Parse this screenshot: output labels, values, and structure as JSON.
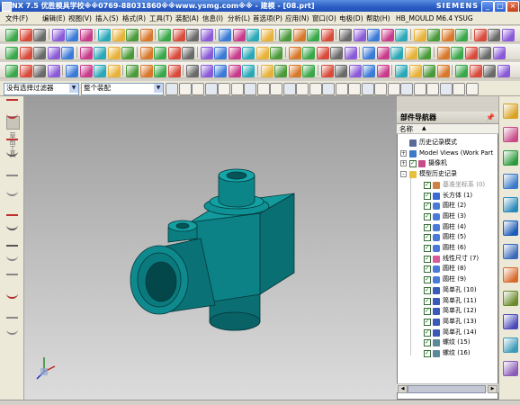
{
  "window": {
    "title": "NX 7.5 优胜模具学校※※0769-88031860※※www.ysmg.com※※ - 建模 - [08.prt]",
    "brand": "SIEMENS",
    "controls": [
      "_",
      "□",
      "×"
    ]
  },
  "menu": {
    "items": [
      "文件(F)",
      "编辑(E)",
      "视图(V)",
      "插入(S)",
      "格式(R)",
      "工具(T)",
      "装配(A)",
      "信息(I)",
      "分析(L)",
      "首选项(P)",
      "应用(N)",
      "窗口(O)",
      "电极(D)",
      "帮助(H)",
      "HB_MOULD M6.4",
      "YSUG"
    ]
  },
  "filter_bar": {
    "selection_filter": "没有选择过滤器",
    "scope": "整个装配"
  },
  "navigator": {
    "title": "部件导航器",
    "column_name": "名称",
    "rows": [
      {
        "label": "历史记录模式",
        "indent": 0,
        "expander": "",
        "checked": false,
        "icon": "history-mode-icon",
        "dim": false
      },
      {
        "label": "Model Views (Work Part)",
        "indent": 0,
        "expander": "+",
        "checked": false,
        "icon": "model-views-icon",
        "dim": false
      },
      {
        "label": "摄像机",
        "indent": 0,
        "expander": "+",
        "checked": true,
        "icon": "camera-icon",
        "dim": false
      },
      {
        "label": "模型历史记录",
        "indent": 0,
        "expander": "-",
        "checked": false,
        "icon": "folder-icon",
        "dim": false
      },
      {
        "label": "基准坐标系 (0)",
        "indent": 1,
        "expander": "",
        "checked": true,
        "icon": "datum-csys-icon",
        "dim": true
      },
      {
        "label": "长方体 (1)",
        "indent": 1,
        "expander": "",
        "checked": true,
        "icon": "block-icon",
        "dim": false
      },
      {
        "label": "圆柱 (2)",
        "indent": 1,
        "expander": "",
        "checked": true,
        "icon": "cylinder-icon",
        "dim": false
      },
      {
        "label": "圆柱 (3)",
        "indent": 1,
        "expander": "",
        "checked": true,
        "icon": "cylinder-icon",
        "dim": false
      },
      {
        "label": "圆柱 (4)",
        "indent": 1,
        "expander": "",
        "checked": true,
        "icon": "cylinder-icon",
        "dim": false
      },
      {
        "label": "圆柱 (5)",
        "indent": 1,
        "expander": "",
        "checked": true,
        "icon": "cylinder-icon",
        "dim": false
      },
      {
        "label": "圆柱 (6)",
        "indent": 1,
        "expander": "",
        "checked": true,
        "icon": "cylinder-icon",
        "dim": false
      },
      {
        "label": "线性尺寸 (7)",
        "indent": 1,
        "expander": "",
        "checked": true,
        "icon": "linear-dimension-icon",
        "dim": false
      },
      {
        "label": "圆柱 (8)",
        "indent": 1,
        "expander": "",
        "checked": true,
        "icon": "cylinder-icon",
        "dim": false
      },
      {
        "label": "圆柱 (9)",
        "indent": 1,
        "expander": "",
        "checked": true,
        "icon": "cylinder-icon",
        "dim": false
      },
      {
        "label": "简单孔 (10)",
        "indent": 1,
        "expander": "",
        "checked": true,
        "icon": "simple-hole-icon",
        "dim": false
      },
      {
        "label": "简单孔 (11)",
        "indent": 1,
        "expander": "",
        "checked": true,
        "icon": "simple-hole-icon",
        "dim": false
      },
      {
        "label": "简单孔 (12)",
        "indent": 1,
        "expander": "",
        "checked": true,
        "icon": "simple-hole-icon",
        "dim": false
      },
      {
        "label": "简单孔 (13)",
        "indent": 1,
        "expander": "",
        "checked": true,
        "icon": "simple-hole-icon",
        "dim": false
      },
      {
        "label": "简单孔 (14)",
        "indent": 1,
        "expander": "",
        "checked": true,
        "icon": "simple-hole-icon",
        "dim": false
      },
      {
        "label": "螺纹 (15)",
        "indent": 1,
        "expander": "",
        "checked": true,
        "icon": "thread-icon",
        "dim": false
      },
      {
        "label": "螺纹 (16)",
        "indent": 1,
        "expander": "",
        "checked": true,
        "icon": "thread-icon",
        "dim": false
      }
    ]
  },
  "left_toolbar": {
    "vertical_label": "草图工具"
  },
  "colors": {
    "model": "#0b7a7e",
    "title_bar": "#2a5cc4",
    "check": "#1a8a1a"
  }
}
